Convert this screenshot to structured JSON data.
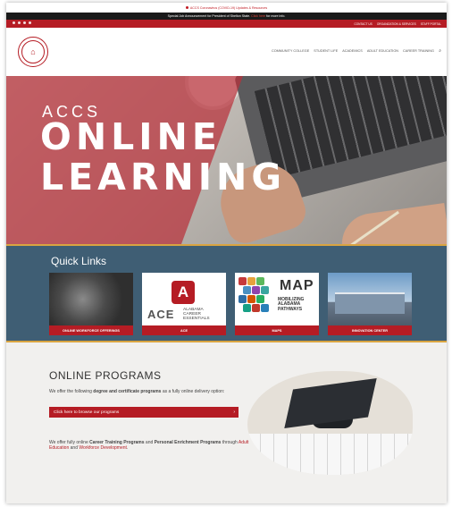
{
  "alerts": {
    "covid_text": "ACCS Coronavirus (COVID-19) Updates & Resources",
    "notice_before": "Special Job Announcement for President of Shelton State.",
    "notice_link": "Click here",
    "notice_after": "for more info."
  },
  "topbar": {
    "social_icons": [
      "facebook-icon",
      "twitter-icon",
      "youtube-icon",
      "instagram-icon"
    ],
    "links": [
      "CONTACT US",
      "ORGANIZATION & SERVICES",
      "STAFF PORTAL"
    ]
  },
  "nav": {
    "items": [
      "COMMUNITY COLLEGE",
      "STUDENT LIFE",
      "ACADEMICS",
      "ADULT EDUCATION",
      "CAREER TRAINING"
    ]
  },
  "hero": {
    "line1": "ACCS",
    "line2": "ONLINE",
    "line3": "LEARNING"
  },
  "quick_links": {
    "title": "Quick Links",
    "cards": [
      {
        "label": "ONLINE WORKFORCE OFFERINGS"
      },
      {
        "label": "ACE"
      },
      {
        "label": "MAPS"
      },
      {
        "label": "INNOVATION CENTER"
      }
    ],
    "ace_big": "ACE",
    "ace_sub": [
      "ALABAMA",
      "CAREER",
      "ESSENTIALS"
    ],
    "maps_big": "MAP",
    "maps_sub": [
      "MOBILIZING",
      "ALABAMA",
      "PATHWAYS"
    ]
  },
  "online_programs": {
    "title": "ONLINE PROGRAMS",
    "text1_a": "We offer the following ",
    "text1_b": "degree and certificate programs",
    "text1_c": " as a fully online delivery option:",
    "button": "Click here to browse our programs",
    "text2_a": "We offer fully online ",
    "text2_b": "Career Training Programs",
    "text2_c": " and ",
    "text2_d": "Personal Enrichment Programs",
    "text2_e": " through ",
    "text2_f": "Adult Education",
    "text2_g": " and ",
    "text2_h": "Workforce Development",
    "text2_i": "."
  },
  "colors": {
    "brand_red": "#b51c24",
    "quick_bg": "#3f5e74",
    "gold": "#d9a441"
  }
}
